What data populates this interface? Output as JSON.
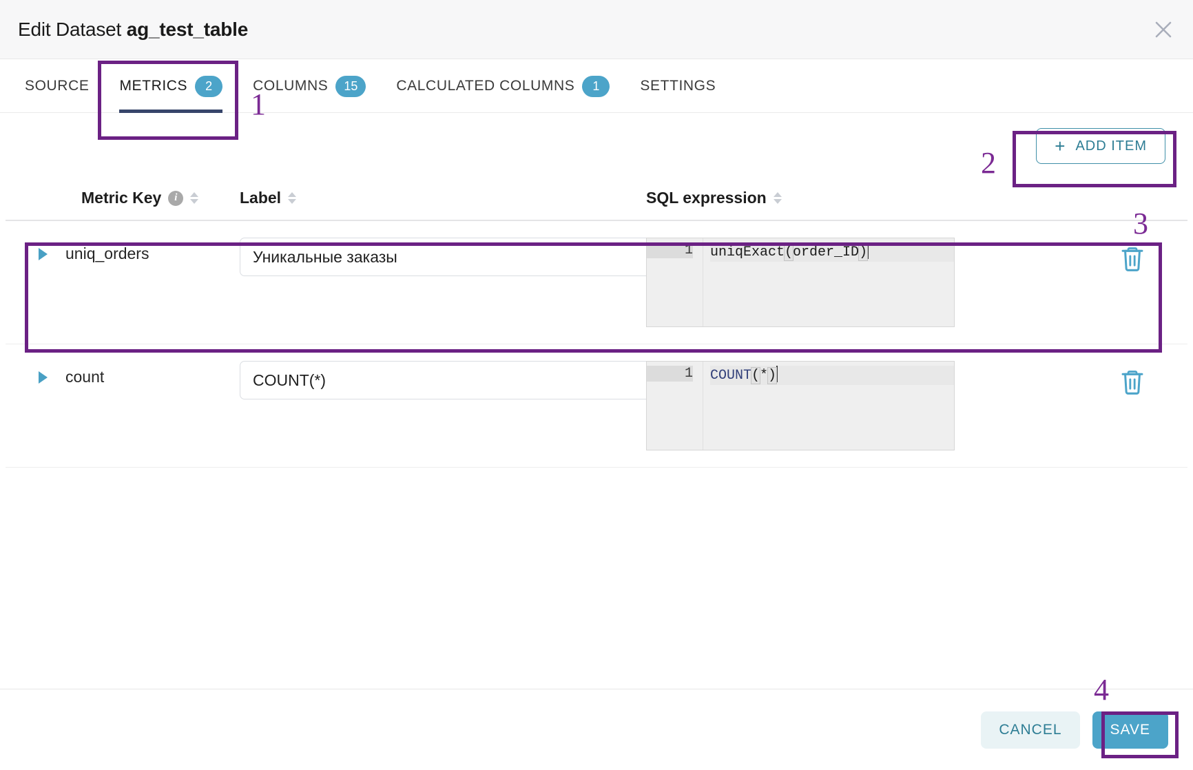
{
  "header": {
    "title_prefix": "Edit Dataset ",
    "dataset_name": "ag_test_table",
    "close_icon": "close-icon"
  },
  "tabs": [
    {
      "label": "SOURCE",
      "badge": null,
      "active": false
    },
    {
      "label": "METRICS",
      "badge": "2",
      "active": true
    },
    {
      "label": "COLUMNS",
      "badge": "15",
      "active": false
    },
    {
      "label": "CALCULATED COLUMNS",
      "badge": "1",
      "active": false
    },
    {
      "label": "SETTINGS",
      "badge": null,
      "active": false
    }
  ],
  "toolbar": {
    "add_item_label": "ADD ITEM",
    "add_item_plus": "+"
  },
  "table": {
    "columns": [
      {
        "label": "Metric Key",
        "has_info": true,
        "sortable": true
      },
      {
        "label": "Label",
        "has_info": false,
        "sortable": true
      },
      {
        "label": "SQL expression",
        "has_info": false,
        "sortable": true
      }
    ],
    "rows": [
      {
        "metric_key": "uniq_orders",
        "label_value": "Уникальные заказы",
        "sql_line_number": "1",
        "sql_fn": "uniqExact",
        "sql_open": "(",
        "sql_arg": "order_ID",
        "sql_close": ")",
        "keyword_colored": false
      },
      {
        "metric_key": "count",
        "label_value": "COUNT(*)",
        "sql_line_number": "1",
        "sql_fn": "COUNT",
        "sql_open": "(",
        "sql_arg": "*",
        "sql_close": ")",
        "keyword_colored": true
      }
    ]
  },
  "footer": {
    "cancel_label": "CANCEL",
    "save_label": "SAVE"
  },
  "annotations": [
    {
      "number": "1"
    },
    {
      "number": "2"
    },
    {
      "number": "3"
    },
    {
      "number": "4"
    }
  ],
  "colors": {
    "accent_teal": "#4ca4c9",
    "annotation_purple": "#6b2184",
    "active_tab_underline": "#37456b",
    "sql_keyword": "#32407a"
  }
}
